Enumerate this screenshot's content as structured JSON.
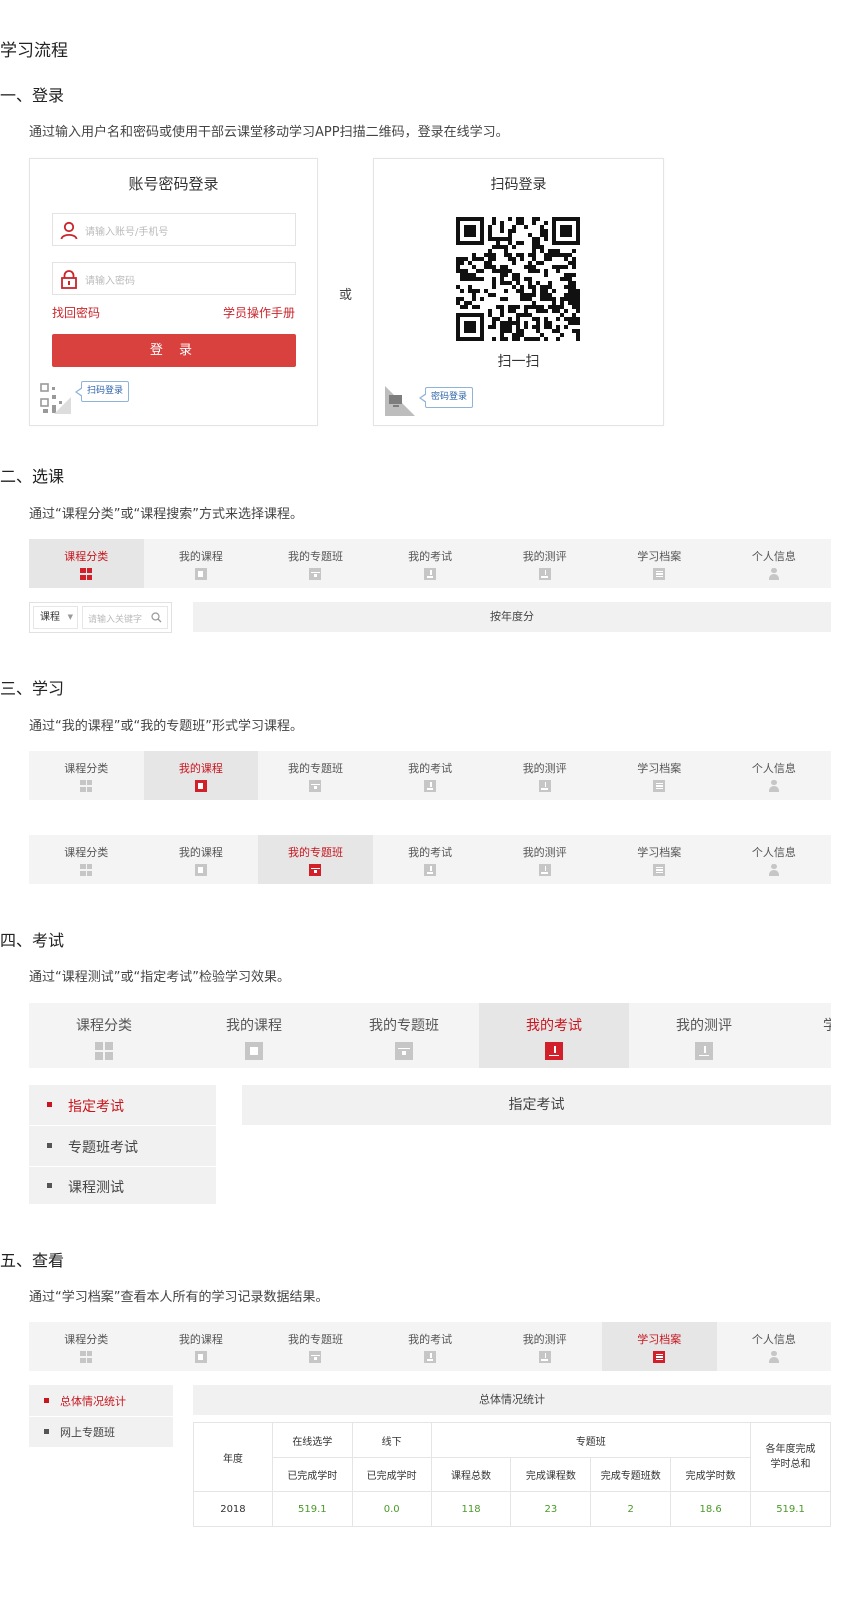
{
  "page_title": "学习流程",
  "colors": {
    "accent": "#c7161e",
    "button": "#d9413f",
    "value_green": "#4a9a28",
    "tab_bg": "#f4f4f4"
  },
  "section1": {
    "heading": "一、登录",
    "desc": "通过输入用户名和密码或使用干部云课堂移动学习APP扫描二维码，登录在线学习。",
    "account_panel": {
      "title": "账号密码登录",
      "username_placeholder": "请输入账号/手机号",
      "password_placeholder": "请输入密码",
      "forgot_link": "找回密码",
      "manual_link": "学员操作手册",
      "login_button": "登 录",
      "switch_tip": "扫码登录"
    },
    "or_text": "或",
    "qr_panel": {
      "title": "扫码登录",
      "scan_text": "扫一扫",
      "switch_tip": "密码登录"
    }
  },
  "section2": {
    "heading": "二、选课",
    "desc": "通过“课程分类”或“课程搜索”方式来选择课程。",
    "search_select": "课程",
    "search_placeholder": "请输入关键字",
    "year_bar": "按年度分"
  },
  "nav_tabs": [
    "课程分类",
    "我的课程",
    "我的专题班",
    "我的考试",
    "我的测评",
    "学习档案",
    "个人信息"
  ],
  "nav_icons": [
    "grid-icon",
    "video-icon",
    "class-icon",
    "exam-icon",
    "evaluate-icon",
    "archive-icon",
    "person-icon"
  ],
  "section3": {
    "heading": "三、学习",
    "desc": "通过“我的课程”或“我的专题班”形式学习课程。"
  },
  "section4": {
    "heading": "四、考试",
    "desc": "通过“课程测试”或“指定考试”检验学习效果。",
    "big_tabs": [
      "课程分类",
      "我的课程",
      "我的专题班",
      "我的考试",
      "我的测评",
      "学"
    ],
    "menu": [
      "指定考试",
      "专题班考试",
      "课程测试"
    ],
    "panel_title": "指定考试"
  },
  "section5": {
    "heading": "五、查看",
    "desc": "通过“学习档案”查看本人所有的学习记录数据结果。",
    "menu": [
      "总体情况统计",
      "网上专题班"
    ],
    "panel_title": "总体情况统计",
    "table": {
      "year_header": "年度",
      "group_online": "在线选学",
      "group_offline": "线下",
      "group_topic": "专题班",
      "total_header": "各年度完成学时总和",
      "sub_online": "已完成学时",
      "sub_offline": "已完成学时",
      "sub_courses": "课程总数",
      "sub_done_courses": "完成课程数",
      "sub_done_classes": "完成专题班数",
      "sub_done_hours": "完成学时数",
      "row": {
        "year": "2018",
        "online": "519.1",
        "offline": "0.0",
        "courses": "118",
        "done_courses": "23",
        "done_classes": "2",
        "done_hours": "18.6",
        "total": "519.1"
      }
    }
  }
}
